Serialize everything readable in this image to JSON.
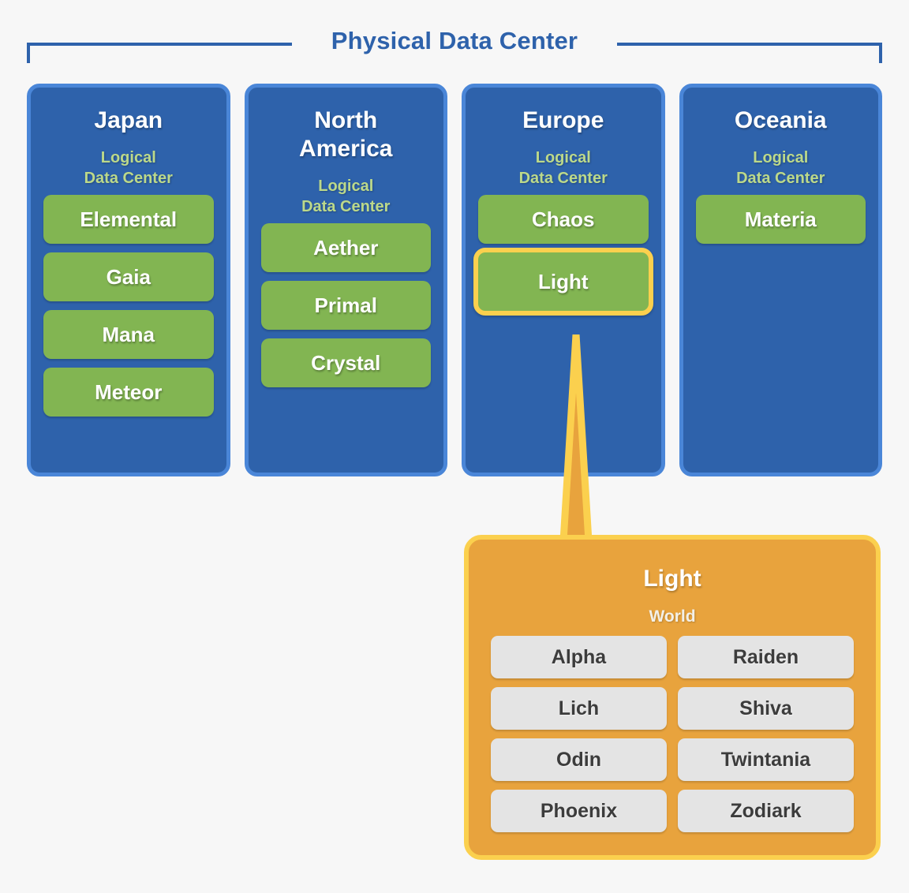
{
  "header": {
    "title": "Physical Data Center",
    "bracket_color": "#2E62AB"
  },
  "colors": {
    "background": "#F7F7F7",
    "panel_fill": "#2E62AB",
    "panel_border": "#4A86D8",
    "logical_chip": "#82B552",
    "highlight": "#FBD04E",
    "world_panel_fill": "#E8A33D",
    "world_chip": "#E4E4E4",
    "subtitle_green": "#BCD98A"
  },
  "physical_data_centers": [
    {
      "name": "Japan",
      "subtitle": "Logical\nData Center",
      "logical_data_centers": [
        {
          "label": "Elemental",
          "selected": false
        },
        {
          "label": "Gaia",
          "selected": false
        },
        {
          "label": "Mana",
          "selected": false
        },
        {
          "label": "Meteor",
          "selected": false
        }
      ]
    },
    {
      "name": "North\nAmerica",
      "subtitle": "Logical\nData Center",
      "logical_data_centers": [
        {
          "label": "Aether",
          "selected": false
        },
        {
          "label": "Primal",
          "selected": false
        },
        {
          "label": "Crystal",
          "selected": false
        }
      ]
    },
    {
      "name": "Europe",
      "subtitle": "Logical\nData Center",
      "logical_data_centers": [
        {
          "label": "Chaos",
          "selected": false
        },
        {
          "label": "Light",
          "selected": true
        }
      ]
    },
    {
      "name": "Oceania",
      "subtitle": "Logical\nData Center",
      "logical_data_centers": [
        {
          "label": "Materia",
          "selected": false
        }
      ]
    }
  ],
  "detail_panel": {
    "title": "Light",
    "subtitle": "World",
    "worlds": [
      "Alpha",
      "Raiden",
      "Lich",
      "Shiva",
      "Odin",
      "Twintania",
      "Phoenix",
      "Zodiark"
    ]
  }
}
